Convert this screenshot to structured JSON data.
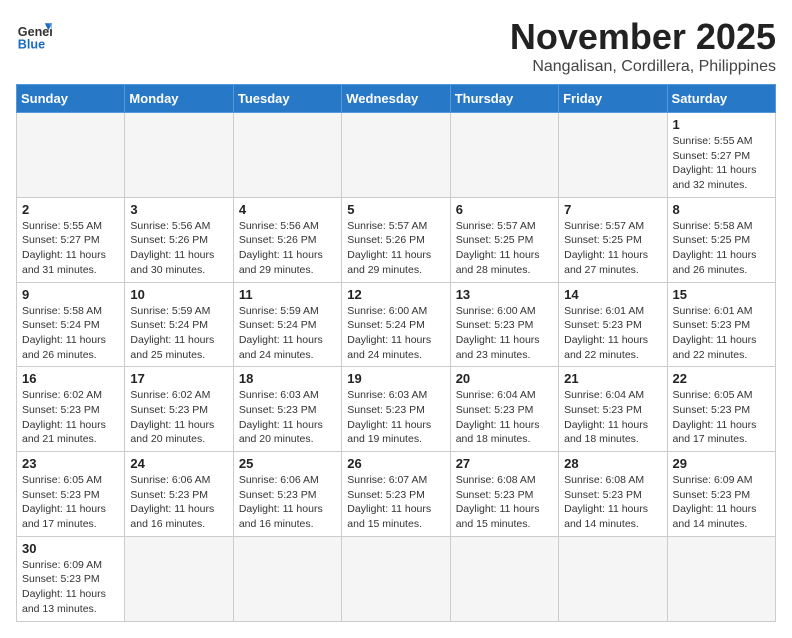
{
  "header": {
    "logo_general": "General",
    "logo_blue": "Blue",
    "month_title": "November 2025",
    "location": "Nangalisan, Cordillera, Philippines"
  },
  "weekdays": [
    "Sunday",
    "Monday",
    "Tuesday",
    "Wednesday",
    "Thursday",
    "Friday",
    "Saturday"
  ],
  "weeks": [
    [
      {
        "day": "",
        "info": ""
      },
      {
        "day": "",
        "info": ""
      },
      {
        "day": "",
        "info": ""
      },
      {
        "day": "",
        "info": ""
      },
      {
        "day": "",
        "info": ""
      },
      {
        "day": "",
        "info": ""
      },
      {
        "day": "1",
        "info": "Sunrise: 5:55 AM\nSunset: 5:27 PM\nDaylight: 11 hours\nand 32 minutes."
      }
    ],
    [
      {
        "day": "2",
        "info": "Sunrise: 5:55 AM\nSunset: 5:27 PM\nDaylight: 11 hours\nand 31 minutes."
      },
      {
        "day": "3",
        "info": "Sunrise: 5:56 AM\nSunset: 5:26 PM\nDaylight: 11 hours\nand 30 minutes."
      },
      {
        "day": "4",
        "info": "Sunrise: 5:56 AM\nSunset: 5:26 PM\nDaylight: 11 hours\nand 29 minutes."
      },
      {
        "day": "5",
        "info": "Sunrise: 5:57 AM\nSunset: 5:26 PM\nDaylight: 11 hours\nand 29 minutes."
      },
      {
        "day": "6",
        "info": "Sunrise: 5:57 AM\nSunset: 5:25 PM\nDaylight: 11 hours\nand 28 minutes."
      },
      {
        "day": "7",
        "info": "Sunrise: 5:57 AM\nSunset: 5:25 PM\nDaylight: 11 hours\nand 27 minutes."
      },
      {
        "day": "8",
        "info": "Sunrise: 5:58 AM\nSunset: 5:25 PM\nDaylight: 11 hours\nand 26 minutes."
      }
    ],
    [
      {
        "day": "9",
        "info": "Sunrise: 5:58 AM\nSunset: 5:24 PM\nDaylight: 11 hours\nand 26 minutes."
      },
      {
        "day": "10",
        "info": "Sunrise: 5:59 AM\nSunset: 5:24 PM\nDaylight: 11 hours\nand 25 minutes."
      },
      {
        "day": "11",
        "info": "Sunrise: 5:59 AM\nSunset: 5:24 PM\nDaylight: 11 hours\nand 24 minutes."
      },
      {
        "day": "12",
        "info": "Sunrise: 6:00 AM\nSunset: 5:24 PM\nDaylight: 11 hours\nand 24 minutes."
      },
      {
        "day": "13",
        "info": "Sunrise: 6:00 AM\nSunset: 5:23 PM\nDaylight: 11 hours\nand 23 minutes."
      },
      {
        "day": "14",
        "info": "Sunrise: 6:01 AM\nSunset: 5:23 PM\nDaylight: 11 hours\nand 22 minutes."
      },
      {
        "day": "15",
        "info": "Sunrise: 6:01 AM\nSunset: 5:23 PM\nDaylight: 11 hours\nand 22 minutes."
      }
    ],
    [
      {
        "day": "16",
        "info": "Sunrise: 6:02 AM\nSunset: 5:23 PM\nDaylight: 11 hours\nand 21 minutes."
      },
      {
        "day": "17",
        "info": "Sunrise: 6:02 AM\nSunset: 5:23 PM\nDaylight: 11 hours\nand 20 minutes."
      },
      {
        "day": "18",
        "info": "Sunrise: 6:03 AM\nSunset: 5:23 PM\nDaylight: 11 hours\nand 20 minutes."
      },
      {
        "day": "19",
        "info": "Sunrise: 6:03 AM\nSunset: 5:23 PM\nDaylight: 11 hours\nand 19 minutes."
      },
      {
        "day": "20",
        "info": "Sunrise: 6:04 AM\nSunset: 5:23 PM\nDaylight: 11 hours\nand 18 minutes."
      },
      {
        "day": "21",
        "info": "Sunrise: 6:04 AM\nSunset: 5:23 PM\nDaylight: 11 hours\nand 18 minutes."
      },
      {
        "day": "22",
        "info": "Sunrise: 6:05 AM\nSunset: 5:23 PM\nDaylight: 11 hours\nand 17 minutes."
      }
    ],
    [
      {
        "day": "23",
        "info": "Sunrise: 6:05 AM\nSunset: 5:23 PM\nDaylight: 11 hours\nand 17 minutes."
      },
      {
        "day": "24",
        "info": "Sunrise: 6:06 AM\nSunset: 5:23 PM\nDaylight: 11 hours\nand 16 minutes."
      },
      {
        "day": "25",
        "info": "Sunrise: 6:06 AM\nSunset: 5:23 PM\nDaylight: 11 hours\nand 16 minutes."
      },
      {
        "day": "26",
        "info": "Sunrise: 6:07 AM\nSunset: 5:23 PM\nDaylight: 11 hours\nand 15 minutes."
      },
      {
        "day": "27",
        "info": "Sunrise: 6:08 AM\nSunset: 5:23 PM\nDaylight: 11 hours\nand 15 minutes."
      },
      {
        "day": "28",
        "info": "Sunrise: 6:08 AM\nSunset: 5:23 PM\nDaylight: 11 hours\nand 14 minutes."
      },
      {
        "day": "29",
        "info": "Sunrise: 6:09 AM\nSunset: 5:23 PM\nDaylight: 11 hours\nand 14 minutes."
      }
    ],
    [
      {
        "day": "30",
        "info": "Sunrise: 6:09 AM\nSunset: 5:23 PM\nDaylight: 11 hours\nand 13 minutes."
      },
      {
        "day": "",
        "info": ""
      },
      {
        "day": "",
        "info": ""
      },
      {
        "day": "",
        "info": ""
      },
      {
        "day": "",
        "info": ""
      },
      {
        "day": "",
        "info": ""
      },
      {
        "day": "",
        "info": ""
      }
    ]
  ]
}
